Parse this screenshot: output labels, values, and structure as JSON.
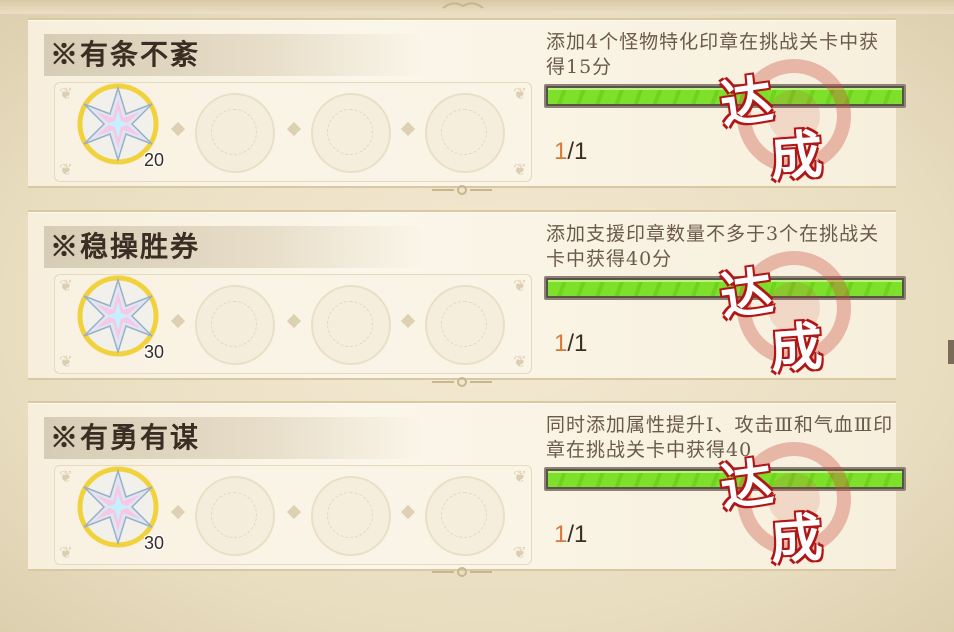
{
  "tasks": [
    {
      "title": "※有条不紊",
      "description": "添加4个怪物特化印章在挑战关卡中获得15分",
      "reward_icon": "crystal-star-icon",
      "reward_count": "20",
      "progress_current": "1",
      "progress_total": "/1",
      "progress_fraction": 1,
      "stamp_chars": [
        "达",
        "成"
      ]
    },
    {
      "title": "※稳操胜券",
      "description": "添加支援印章数量不多于3个在挑战关卡中获得40分",
      "reward_icon": "crystal-star-icon",
      "reward_count": "30",
      "progress_current": "1",
      "progress_total": "/1",
      "progress_fraction": 1,
      "stamp_chars": [
        "达",
        "成"
      ]
    },
    {
      "title": "※有勇有谋",
      "description": "同时添加属性提升Ⅰ、攻击Ⅲ和气血Ⅲ印章在挑战关卡中获得40",
      "reward_icon": "crystal-star-icon",
      "reward_count": "30",
      "progress_current": "1",
      "progress_total": "/1",
      "progress_fraction": 1,
      "stamp_chars": [
        "达",
        "成"
      ]
    }
  ],
  "colors": {
    "progress_fill": "#7ee02b",
    "stamp_red": "#b01818",
    "current_value": "#d97a3c"
  }
}
